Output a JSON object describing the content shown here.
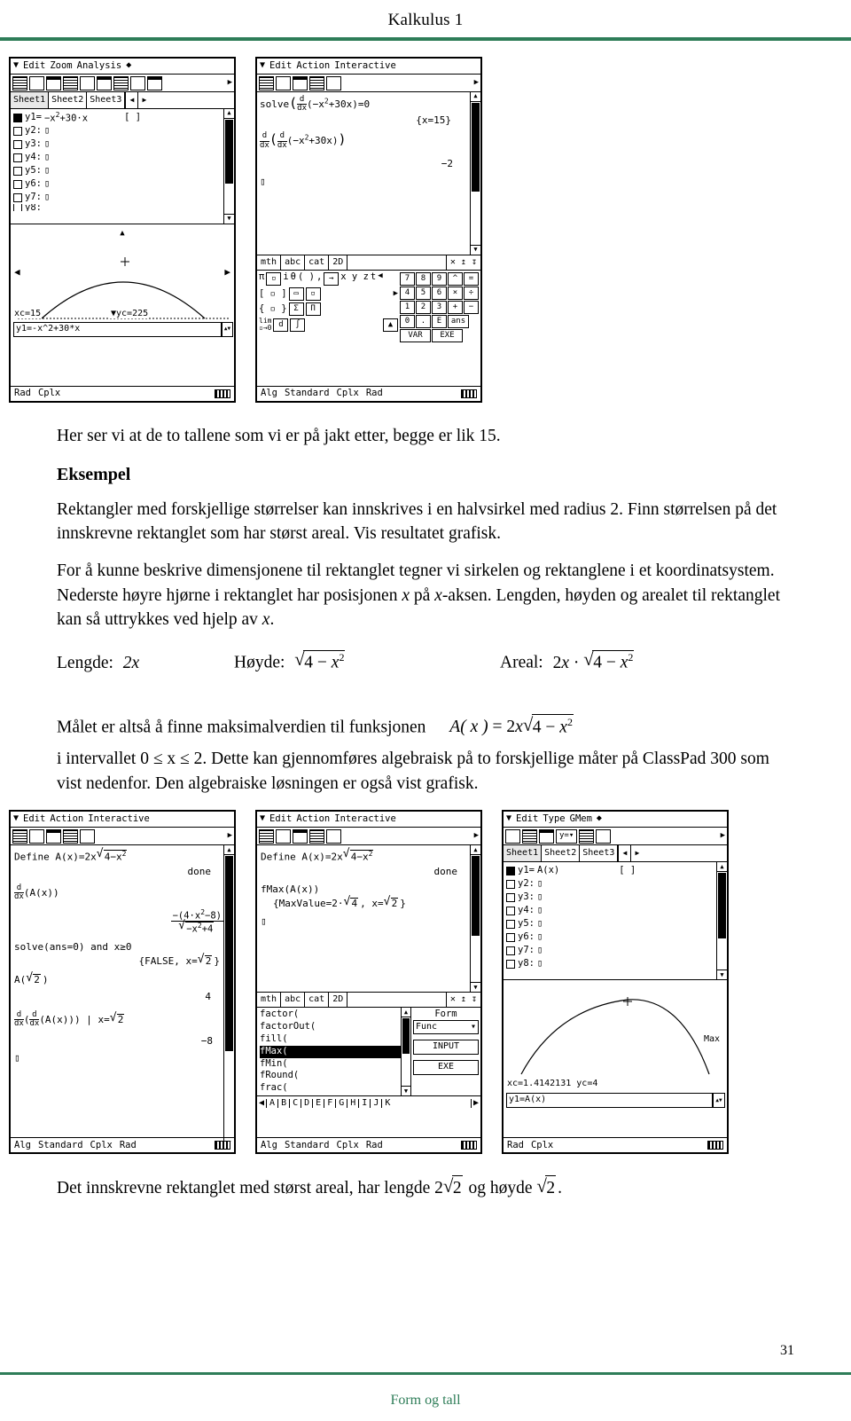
{
  "header": {
    "title": "Kalkulus 1"
  },
  "footer": {
    "title": "Form og tall",
    "page_number": "31"
  },
  "body": {
    "intro": "Her ser vi at de to tallene som vi er på jakt etter, begge er lik 15.",
    "section_heading": "Eksempel",
    "p1": "Rektangler med forskjellige størrelser kan innskrives i en halvsirkel med radius 2. Finn størrelsen på det innskrevne rektanglet som har størst areal. Vis resultatet grafisk.",
    "p2_a": "For å kunne beskrive dimensjonene til rektanglet tegner vi sirkelen og rektanglene i et koordinatsystem. Nederste høyre hjørne i rektanglet har posisjonen ",
    "p2_x1": "x",
    "p2_b": " på ",
    "p2_x2": "x",
    "p2_c": "-aksen. Lengden, høyden og arealet til rektanglet kan så uttrykkes ved hjelp av ",
    "p2_x3": "x",
    "p2_d": ".",
    "formula_lengde_label": "Lengde:",
    "formula_lengde_value": "2x",
    "formula_hoyde_label": "Høyde:",
    "formula_hoyde_radicand": "4 − x",
    "formula_hoyde_exp": "2",
    "formula_areal_label": "Areal:",
    "formula_areal_prefix": "2x ·",
    "formula_areal_radicand": "4 − x",
    "formula_areal_exp": "2",
    "p3_a": "Målet er altså å finne maksimalverdien til funksjonen",
    "p3_func_prefix": "A",
    "p3_func_paren": "( x )",
    "p3_func_eq": "= 2x",
    "p3_func_radicand": "4 − x",
    "p3_func_exp": "2",
    "p4": "i intervallet 0 ≤ x ≤ 2. Dette kan gjennomføres algebraisk på to forskjellige måter på ClassPad 300 som vist nedenfor. Den algebraiske løsningen er også vist grafisk.",
    "closing_a": "Det innskrevne rektanglet med størst areal, har lengde",
    "closing_r1": "2",
    "closing_r1_rad": "2",
    "closing_b": "og høyde",
    "closing_r2_rad": "2",
    "closing_c": "."
  },
  "calc_top_left": {
    "menu": [
      "Edit",
      "Zoom",
      "Analysis"
    ],
    "tabs": [
      "Sheet1",
      "Sheet2",
      "Sheet3"
    ],
    "rows": [
      {
        "label": "y1=",
        "expr": "−x²+30·x",
        "checked": true
      },
      {
        "label": "y2:",
        "expr": "",
        "checked": false
      },
      {
        "label": "y3:",
        "expr": "",
        "checked": false
      },
      {
        "label": "y4:",
        "expr": "",
        "checked": false
      },
      {
        "label": "y5:",
        "expr": "",
        "checked": false
      },
      {
        "label": "y6:",
        "expr": "",
        "checked": false
      },
      {
        "label": "y7:",
        "expr": "",
        "checked": false
      },
      {
        "label": "y8:",
        "expr": "",
        "checked": false
      }
    ],
    "bracket": "[   ]",
    "graph_xc": "xc=15",
    "graph_yc": "yc=225",
    "graph_entry": "y1=-x^2+30*x",
    "status": [
      "Rad",
      "Cplx"
    ]
  },
  "calc_top_right": {
    "menu": [
      "Edit",
      "Action",
      "Interactive"
    ],
    "lines": [
      "solve(d/dx(−x²+30x)=0",
      "{x=15}",
      "d/dx( d/dx(−x²+30x) )",
      "−2"
    ],
    "kbd_tabs": [
      "mth",
      "abc",
      "cat",
      "2D"
    ],
    "keys_row1": [
      "7",
      "8",
      "9",
      "^",
      "="
    ],
    "keys_row2": [
      "4",
      "5",
      "6",
      "×",
      "÷"
    ],
    "keys_row3": [
      "1",
      "2",
      "3",
      "+",
      "−"
    ],
    "keys_row4": [
      "0",
      ".",
      "E",
      "ans"
    ],
    "key_var": "VAR",
    "key_exe": "EXE",
    "status": [
      "Alg",
      "Standard",
      "Cplx",
      "Rad"
    ]
  },
  "calc_bottom_left": {
    "menu": [
      "Edit",
      "Action",
      "Interactive"
    ],
    "lines": [
      "Define A(x)=2x√(4−x²)",
      "done",
      "d/dx(A(x))",
      "−(4·x²−8)",
      "√(−x²+4)",
      "solve(ans=0) and x≥0",
      "{FALSE, x=√2 }",
      "A(√2 )",
      "4",
      "d/dx( d/dx(A(x)) ) | x=√2",
      "−8"
    ],
    "status": [
      "Alg",
      "Standard",
      "Cplx",
      "Rad"
    ]
  },
  "calc_bottom_mid": {
    "menu": [
      "Edit",
      "Action",
      "Interactive"
    ],
    "lines": [
      "Define A(x)=2x√(4−x²)",
      "done",
      "fMax(A(x))",
      "{MaxValue=2·√4 , x=√2 }"
    ],
    "kbd_tabs": [
      "mth",
      "abc",
      "cat",
      "2D"
    ],
    "catalog": [
      "factor(",
      "factorOut(",
      "fill(",
      "fMax(",
      "fMin(",
      "fRound(",
      "frac("
    ],
    "catalog_selected": "fMax(",
    "form_label": "Form",
    "form_value": "Func",
    "btn_input": "INPUT",
    "btn_exe": "EXE",
    "letters": [
      "A",
      "B",
      "C",
      "D",
      "E",
      "F",
      "G",
      "H",
      "I",
      "J",
      "K"
    ],
    "status": [
      "Alg",
      "Standard",
      "Cplx",
      "Rad"
    ]
  },
  "calc_bottom_right": {
    "menu": [
      "Edit",
      "Type",
      "GMem"
    ],
    "tabs": [
      "Sheet1",
      "Sheet2",
      "Sheet3"
    ],
    "rows": [
      {
        "label": "y1=",
        "expr": "A(x)",
        "checked": true
      },
      {
        "label": "y2:",
        "expr": "",
        "checked": false
      },
      {
        "label": "y3:",
        "expr": "",
        "checked": false
      },
      {
        "label": "y4:",
        "expr": "",
        "checked": false
      },
      {
        "label": "y5:",
        "expr": "",
        "checked": false
      },
      {
        "label": "y6:",
        "expr": "",
        "checked": false
      },
      {
        "label": "y7:",
        "expr": "",
        "checked": false
      },
      {
        "label": "y8:",
        "expr": "",
        "checked": false
      }
    ],
    "bracket": "[   ]",
    "dropdown_y": "y=",
    "graph_label": "Max",
    "graph_xc": "xc=1.4142131",
    "graph_yc": "yc=4",
    "graph_entry": "y1=A(x)",
    "status": [
      "Rad",
      "Cplx"
    ]
  }
}
